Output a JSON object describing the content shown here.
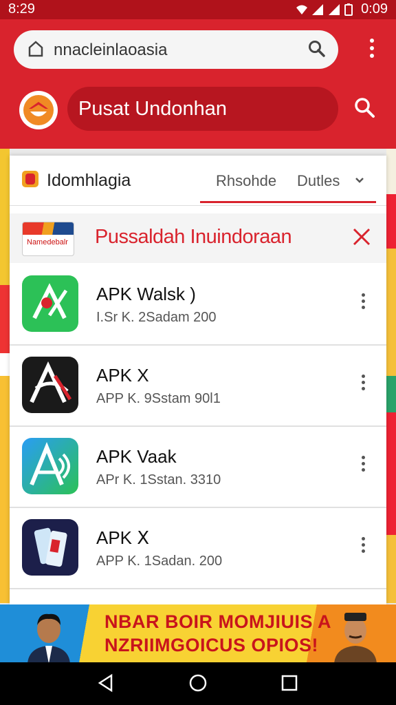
{
  "status_bar": {
    "time_left": "8:29",
    "time_right": "0:09"
  },
  "browser": {
    "url": "nnacleinlaoasia",
    "site_title": "Pusat Undonhan"
  },
  "card": {
    "app_name": "Idomhlagia",
    "tab1": "Rhsohde",
    "tab2": "Dutles",
    "banner_title": "Pussaldah Inuindoraan",
    "banner_thumb_text": "Namedebalr"
  },
  "list": [
    {
      "title": "APK Walsk      )",
      "subtitle": "I.Sr K.  2Sadam 200",
      "icon": "green-apk-icon"
    },
    {
      "title": "APK X",
      "subtitle": "APP K.  9Sstam 90l1",
      "icon": "black-apk-icon"
    },
    {
      "title": "APK Vaak",
      "subtitle": "APr K.  1Sstan. 3310",
      "icon": "gradient-apk-icon"
    },
    {
      "title": "APK Ⅹ",
      "subtitle": "APP K.  1Sadan. 200",
      "icon": "phone-apk-icon"
    }
  ],
  "ad": {
    "line1": "NBAR BOIR MOMJIUIS A",
    "line2": "NZRIIMGOICUS OPIOS!"
  },
  "colors": {
    "brand_red": "#d9232d",
    "status_red": "#b0121b"
  }
}
